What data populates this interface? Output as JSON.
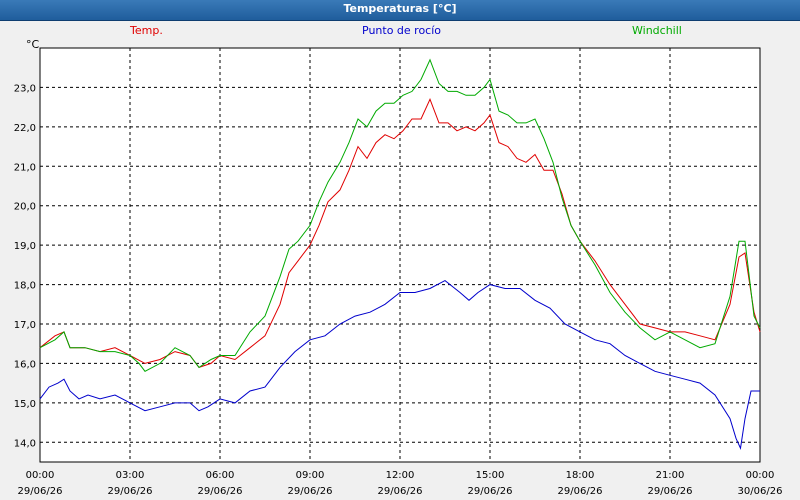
{
  "window": {
    "title": "Temperaturas [°C]"
  },
  "chart_data": {
    "type": "line",
    "title": "Temperaturas [°C]",
    "ylabel": "°C",
    "ylim": [
      13.5,
      24.0
    ],
    "yticks": [
      14.0,
      15.0,
      16.0,
      17.0,
      18.0,
      19.0,
      20.0,
      21.0,
      22.0,
      23.0
    ],
    "ytick_labels": [
      "14,0",
      "15,0",
      "16,0",
      "17,0",
      "18,0",
      "19,0",
      "20,0",
      "21,0",
      "22,0",
      "23,0"
    ],
    "xlim_hours": [
      0,
      24
    ],
    "xticks": [
      {
        "h": 0,
        "time": "00:00",
        "date": "29/06/26"
      },
      {
        "h": 3,
        "time": "03:00",
        "date": "29/06/26"
      },
      {
        "h": 6,
        "time": "06:00",
        "date": "29/06/26"
      },
      {
        "h": 9,
        "time": "09:00",
        "date": "29/06/26"
      },
      {
        "h": 12,
        "time": "12:00",
        "date": "29/06/26"
      },
      {
        "h": 15,
        "time": "15:00",
        "date": "29/06/26"
      },
      {
        "h": 18,
        "time": "18:00",
        "date": "29/06/26"
      },
      {
        "h": 21,
        "time": "21:00",
        "date": "29/06/26"
      },
      {
        "h": 24,
        "time": "00:00",
        "date": "30/06/26"
      }
    ],
    "grid": true,
    "legend_position": "top",
    "series": [
      {
        "name": "Temp.",
        "color": "#e00000",
        "points": [
          [
            0,
            16.4
          ],
          [
            0.5,
            16.7
          ],
          [
            0.8,
            16.8
          ],
          [
            1,
            16.4
          ],
          [
            1.5,
            16.4
          ],
          [
            2,
            16.3
          ],
          [
            2.5,
            16.4
          ],
          [
            3,
            16.2
          ],
          [
            3.5,
            16.0
          ],
          [
            4,
            16.1
          ],
          [
            4.5,
            16.3
          ],
          [
            5,
            16.2
          ],
          [
            5.3,
            15.9
          ],
          [
            5.7,
            16.0
          ],
          [
            6,
            16.2
          ],
          [
            6.5,
            16.1
          ],
          [
            7,
            16.4
          ],
          [
            7.5,
            16.7
          ],
          [
            8,
            17.5
          ],
          [
            8.3,
            18.3
          ],
          [
            8.6,
            18.6
          ],
          [
            9,
            19.0
          ],
          [
            9.3,
            19.5
          ],
          [
            9.6,
            20.1
          ],
          [
            10,
            20.4
          ],
          [
            10.3,
            20.9
          ],
          [
            10.6,
            21.5
          ],
          [
            10.9,
            21.2
          ],
          [
            11.2,
            21.6
          ],
          [
            11.5,
            21.8
          ],
          [
            11.8,
            21.7
          ],
          [
            12.1,
            21.9
          ],
          [
            12.4,
            22.2
          ],
          [
            12.7,
            22.2
          ],
          [
            13,
            22.7
          ],
          [
            13.3,
            22.1
          ],
          [
            13.6,
            22.1
          ],
          [
            13.9,
            21.9
          ],
          [
            14.2,
            22.0
          ],
          [
            14.5,
            21.9
          ],
          [
            14.8,
            22.1
          ],
          [
            15,
            22.3
          ],
          [
            15.3,
            21.6
          ],
          [
            15.6,
            21.5
          ],
          [
            15.9,
            21.2
          ],
          [
            16.2,
            21.1
          ],
          [
            16.5,
            21.3
          ],
          [
            16.8,
            20.9
          ],
          [
            17.1,
            20.9
          ],
          [
            17.4,
            20.3
          ],
          [
            17.7,
            19.5
          ],
          [
            18,
            19.1
          ],
          [
            18.5,
            18.6
          ],
          [
            19,
            18.0
          ],
          [
            19.5,
            17.5
          ],
          [
            20,
            17.0
          ],
          [
            20.5,
            16.9
          ],
          [
            21,
            16.8
          ],
          [
            21.5,
            16.8
          ],
          [
            22,
            16.7
          ],
          [
            22.5,
            16.6
          ],
          [
            23,
            17.5
          ],
          [
            23.3,
            18.7
          ],
          [
            23.5,
            18.8
          ],
          [
            23.8,
            17.3
          ],
          [
            24,
            16.8
          ]
        ]
      },
      {
        "name": "Punto de rocío",
        "color": "#0000cc",
        "points": [
          [
            0,
            15.1
          ],
          [
            0.3,
            15.4
          ],
          [
            0.6,
            15.5
          ],
          [
            0.8,
            15.6
          ],
          [
            1,
            15.3
          ],
          [
            1.3,
            15.1
          ],
          [
            1.6,
            15.2
          ],
          [
            2,
            15.1
          ],
          [
            2.5,
            15.2
          ],
          [
            3,
            15.0
          ],
          [
            3.5,
            14.8
          ],
          [
            4,
            14.9
          ],
          [
            4.5,
            15.0
          ],
          [
            5,
            15.0
          ],
          [
            5.3,
            14.8
          ],
          [
            5.6,
            14.9
          ],
          [
            6,
            15.1
          ],
          [
            6.5,
            15.0
          ],
          [
            7,
            15.3
          ],
          [
            7.5,
            15.4
          ],
          [
            8,
            15.9
          ],
          [
            8.5,
            16.3
          ],
          [
            9,
            16.6
          ],
          [
            9.5,
            16.7
          ],
          [
            10,
            17.0
          ],
          [
            10.5,
            17.2
          ],
          [
            11,
            17.3
          ],
          [
            11.5,
            17.5
          ],
          [
            12,
            17.8
          ],
          [
            12.5,
            17.8
          ],
          [
            13,
            17.9
          ],
          [
            13.5,
            18.1
          ],
          [
            14,
            17.8
          ],
          [
            14.3,
            17.6
          ],
          [
            14.6,
            17.8
          ],
          [
            15,
            18.0
          ],
          [
            15.5,
            17.9
          ],
          [
            16,
            17.9
          ],
          [
            16.5,
            17.6
          ],
          [
            17,
            17.4
          ],
          [
            17.5,
            17.0
          ],
          [
            18,
            16.8
          ],
          [
            18.5,
            16.6
          ],
          [
            19,
            16.5
          ],
          [
            19.5,
            16.2
          ],
          [
            20,
            16.0
          ],
          [
            20.5,
            15.8
          ],
          [
            21,
            15.7
          ],
          [
            21.5,
            15.6
          ],
          [
            22,
            15.5
          ],
          [
            22.5,
            15.2
          ],
          [
            23,
            14.6
          ],
          [
            23.2,
            14.1
          ],
          [
            23.35,
            13.85
          ],
          [
            23.5,
            14.6
          ],
          [
            23.7,
            15.3
          ],
          [
            24,
            15.3
          ]
        ]
      },
      {
        "name": "Windchill",
        "color": "#00aa00",
        "points": [
          [
            0,
            16.4
          ],
          [
            0.5,
            16.6
          ],
          [
            0.8,
            16.8
          ],
          [
            1,
            16.4
          ],
          [
            1.5,
            16.4
          ],
          [
            2,
            16.3
          ],
          [
            2.5,
            16.3
          ],
          [
            3,
            16.2
          ],
          [
            3.3,
            16.0
          ],
          [
            3.5,
            15.8
          ],
          [
            4,
            16.0
          ],
          [
            4.5,
            16.4
          ],
          [
            5,
            16.2
          ],
          [
            5.3,
            15.9
          ],
          [
            5.7,
            16.1
          ],
          [
            6,
            16.2
          ],
          [
            6.5,
            16.2
          ],
          [
            7,
            16.8
          ],
          [
            7.5,
            17.2
          ],
          [
            8,
            18.2
          ],
          [
            8.3,
            18.9
          ],
          [
            8.6,
            19.1
          ],
          [
            9,
            19.5
          ],
          [
            9.3,
            20.1
          ],
          [
            9.6,
            20.6
          ],
          [
            10,
            21.1
          ],
          [
            10.3,
            21.6
          ],
          [
            10.6,
            22.2
          ],
          [
            10.9,
            22.0
          ],
          [
            11.2,
            22.4
          ],
          [
            11.5,
            22.6
          ],
          [
            11.8,
            22.6
          ],
          [
            12.1,
            22.8
          ],
          [
            12.4,
            22.9
          ],
          [
            12.7,
            23.2
          ],
          [
            13,
            23.7
          ],
          [
            13.3,
            23.1
          ],
          [
            13.6,
            22.9
          ],
          [
            13.9,
            22.9
          ],
          [
            14.2,
            22.8
          ],
          [
            14.5,
            22.8
          ],
          [
            14.8,
            23.0
          ],
          [
            15,
            23.2
          ],
          [
            15.3,
            22.4
          ],
          [
            15.6,
            22.3
          ],
          [
            15.9,
            22.1
          ],
          [
            16.2,
            22.1
          ],
          [
            16.5,
            22.2
          ],
          [
            16.8,
            21.7
          ],
          [
            17.1,
            21.1
          ],
          [
            17.4,
            20.2
          ],
          [
            17.7,
            19.5
          ],
          [
            18,
            19.1
          ],
          [
            18.5,
            18.5
          ],
          [
            19,
            17.8
          ],
          [
            19.5,
            17.3
          ],
          [
            20,
            16.9
          ],
          [
            20.5,
            16.6
          ],
          [
            21,
            16.8
          ],
          [
            21.5,
            16.6
          ],
          [
            22,
            16.4
          ],
          [
            22.5,
            16.5
          ],
          [
            23,
            17.7
          ],
          [
            23.3,
            19.1
          ],
          [
            23.5,
            19.1
          ],
          [
            23.8,
            17.2
          ],
          [
            24,
            16.9
          ]
        ]
      }
    ]
  }
}
